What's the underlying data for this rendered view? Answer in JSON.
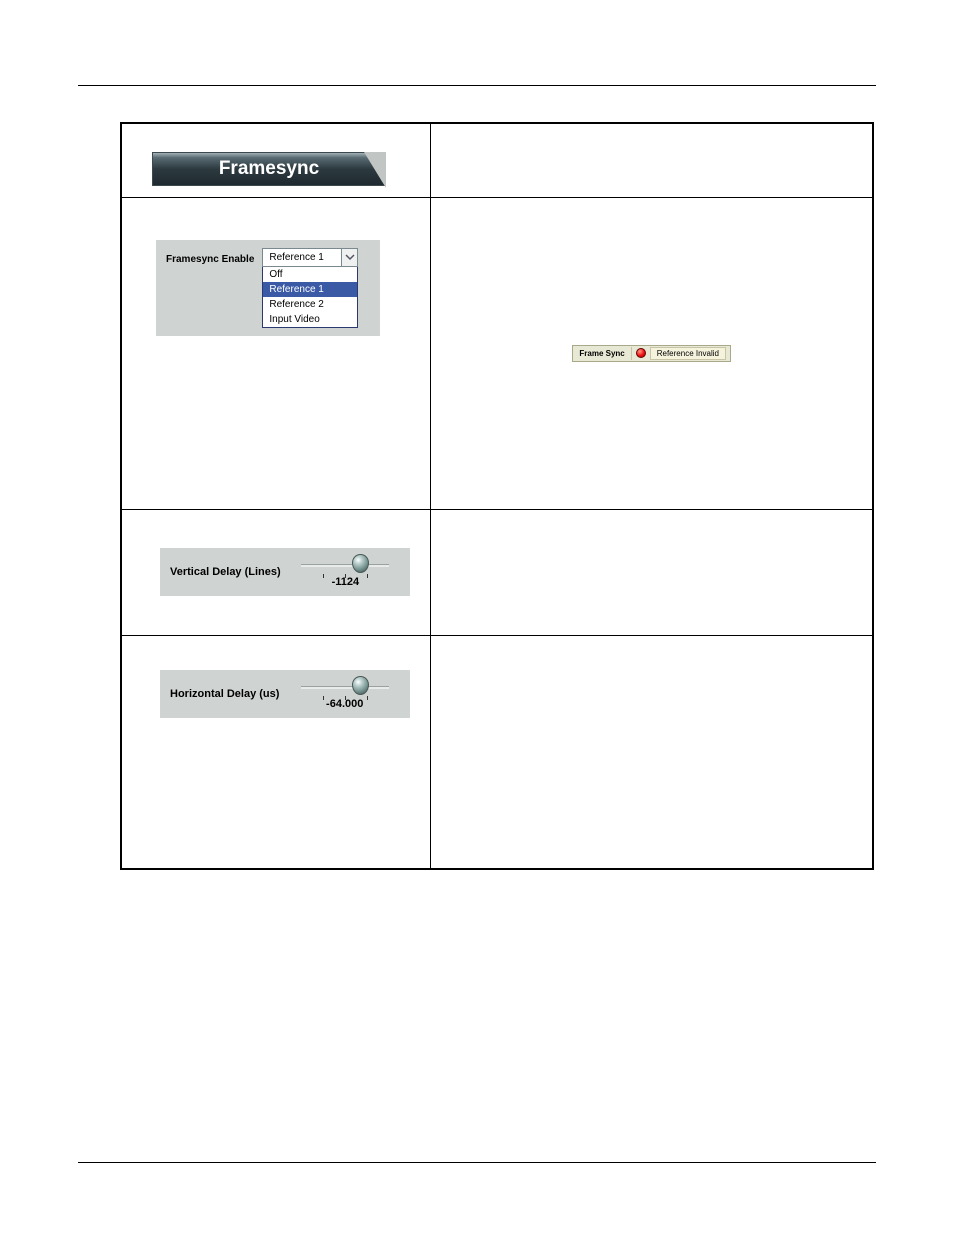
{
  "tab": {
    "title": "Framesync"
  },
  "enable": {
    "label": "Framesync Enable",
    "selected": "Reference 1",
    "options": {
      "o1": "Off",
      "o2": "Reference 1",
      "o3": "Reference 2",
      "o4": "Input Video"
    }
  },
  "status": {
    "label": "Frame Sync",
    "text": "Reference Invalid"
  },
  "vdelay": {
    "label": "Vertical Delay (Lines)",
    "value": "-1124"
  },
  "hdelay": {
    "label": "Horizontal Delay (us)",
    "value": "-64.000"
  }
}
